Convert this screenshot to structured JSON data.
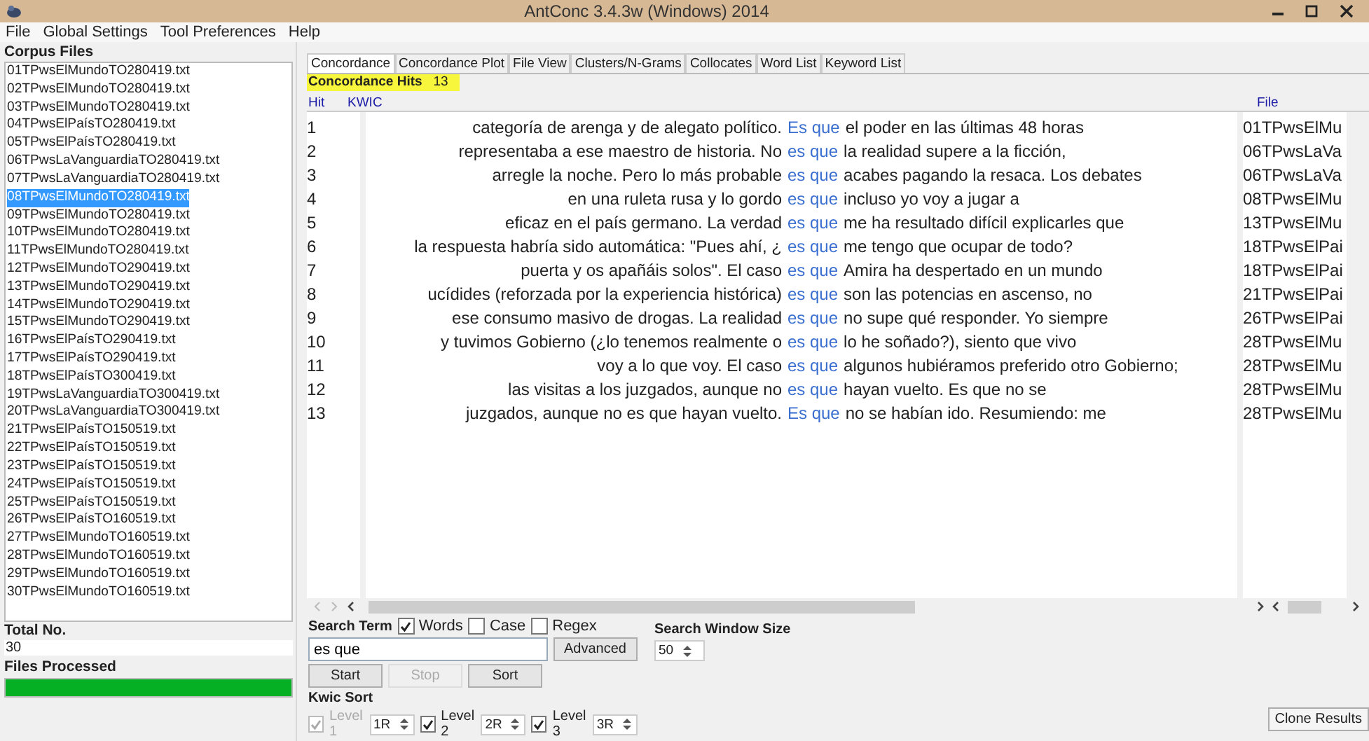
{
  "window": {
    "title": "AntConc 3.4.3w (Windows) 2014"
  },
  "menu": [
    "File",
    "Global Settings",
    "Tool Preferences",
    "Help"
  ],
  "corpus_files": {
    "heading": "Corpus Files",
    "items": [
      {
        "name": "01TPwsElMundoTO280419.txt",
        "selected": false
      },
      {
        "name": "02TPwsElMundoTO280419.txt",
        "selected": false
      },
      {
        "name": "03TPwsElMundoTO280419.txt",
        "selected": false
      },
      {
        "name": "04TPwsElPaísTO280419.txt",
        "selected": false
      },
      {
        "name": "05TPwsElPaísTO280419.txt",
        "selected": false
      },
      {
        "name": "06TPwsLaVanguardiaTO280419.txt",
        "selected": false
      },
      {
        "name": "07TPwsLaVanguardiaTO280419.txt",
        "selected": false
      },
      {
        "name": "08TPwsElMundoTO280419.txt",
        "selected": true
      },
      {
        "name": "09TPwsElMundoTO280419.txt",
        "selected": false
      },
      {
        "name": "10TPwsElMundoTO280419.txt",
        "selected": false
      },
      {
        "name": "11TPwsElMundoTO280419.txt",
        "selected": false
      },
      {
        "name": "12TPwsElMundoTO290419.txt",
        "selected": false
      },
      {
        "name": "13TPwsElMundoTO290419.txt",
        "selected": false
      },
      {
        "name": "14TPwsElMundoTO290419.txt",
        "selected": false
      },
      {
        "name": "15TPwsElMundoTO290419.txt",
        "selected": false
      },
      {
        "name": "16TPwsElPaísTO290419.txt",
        "selected": false
      },
      {
        "name": "17TPwsElPaísTO290419.txt",
        "selected": false
      },
      {
        "name": "18TPwsElPaísTO300419.txt",
        "selected": false
      },
      {
        "name": "19TPwsLaVanguardiaTO300419.txt",
        "selected": false
      },
      {
        "name": "20TPwsLaVanguardiaTO300419.txt",
        "selected": false
      },
      {
        "name": "21TPwsElPaísTO150519.txt",
        "selected": false
      },
      {
        "name": "22TPwsElPaísTO150519.txt",
        "selected": false
      },
      {
        "name": "23TPwsElPaísTO150519.txt",
        "selected": false
      },
      {
        "name": "24TPwsElPaísTO150519.txt",
        "selected": false
      },
      {
        "name": "25TPwsElPaísTO150519.txt",
        "selected": false
      },
      {
        "name": "26TPwsElPaísTO160519.txt",
        "selected": false
      },
      {
        "name": "27TPwsElMundoTO160519.txt",
        "selected": false
      },
      {
        "name": "28TPwsElMundoTO160519.txt",
        "selected": false
      },
      {
        "name": "29TPwsElMundoTO160519.txt",
        "selected": false
      },
      {
        "name": "30TPwsElMundoTO160519.txt",
        "selected": false
      }
    ]
  },
  "total": {
    "label": "Total No.",
    "value": "30"
  },
  "files_processed": {
    "label": "Files Processed",
    "level": 1
  },
  "tabs": [
    {
      "label": "Concordance",
      "selected": true
    },
    {
      "label": "Concordance Plot",
      "selected": false
    },
    {
      "label": "File View",
      "selected": false
    },
    {
      "label": "Clusters/N-Grams",
      "selected": false
    },
    {
      "label": "Collocates",
      "selected": false
    },
    {
      "label": "Word List",
      "selected": false
    },
    {
      "label": "Keyword List",
      "selected": false
    }
  ],
  "hits": {
    "label": "Concordance Hits",
    "count": "13"
  },
  "columns": [
    "Hit",
    "KWIC",
    "File"
  ],
  "rows": [
    {
      "hit": "1",
      "left": "categoría de arenga y de alegato político.",
      "keyword": "Es que",
      "right": "el poder en las últimas 48 horas",
      "file": "01TPwsElMu"
    },
    {
      "hit": "2",
      "left": "representaba a ese maestro de historia. No",
      "keyword": "es que",
      "right": "la realidad supere a la ficción,",
      "file": "06TPwsLaVa"
    },
    {
      "hit": "3",
      "left": "arregle la noche. Pero lo más probable",
      "keyword": "es que",
      "right": "acabes pagando la resaca. Los debates",
      "file": "06TPwsLaVa"
    },
    {
      "hit": "4",
      "left": "en una ruleta rusa y lo gordo",
      "keyword": "es que",
      "right": "incluso yo voy a jugar a",
      "file": "08TPwsElMu"
    },
    {
      "hit": "5",
      "left": "eficaz en el país germano.  La verdad",
      "keyword": "es que",
      "right": "me ha resultado difícil explicarles que",
      "file": "13TPwsElMu"
    },
    {
      "hit": "6",
      "left": "la respuesta habría sido automática: \"Pues ahí, ¿",
      "keyword": "es que",
      "right": "me tengo que ocupar de todo?",
      "file": "18TPwsElPai"
    },
    {
      "hit": "7",
      "left": "puerta y os apañáis solos\".  El caso",
      "keyword": "es que",
      "right": "Amira ha despertado en un mundo",
      "file": "18TPwsElPai"
    },
    {
      "hit": "8",
      "left": "ucídides (reforzada por la experiencia histórica)",
      "keyword": "es que",
      "right": "son las potencias en ascenso, no",
      "file": "21TPwsElPai"
    },
    {
      "hit": "9",
      "left": "ese consumo masivo de drogas. La realidad",
      "keyword": "es que",
      "right": "no supe qué responder. Yo siempre",
      "file": "26TPwsElPai"
    },
    {
      "hit": "10",
      "left": "y tuvimos Gobierno (¿lo tenemos realmente o",
      "keyword": "es que",
      "right": "lo he soñado?), siento que vivo",
      "file": "28TPwsElMu"
    },
    {
      "hit": "11",
      "left": "voy a lo que voy. El caso",
      "keyword": "es que",
      "right": "algunos hubiéramos preferido otro Gobierno;",
      "file": "28TPwsElMu"
    },
    {
      "hit": "12",
      "left": "las visitas a los juzgados, aunque no",
      "keyword": "es que",
      "right": "hayan vuelto. Es que no se",
      "file": "28TPwsElMu"
    },
    {
      "hit": "13",
      "left": "juzgados, aunque no es que hayan vuelto.",
      "keyword": "Es que",
      "right": "no se habían ido. Resumiendo: me",
      "file": "28TPwsElMu"
    }
  ],
  "search": {
    "label": "Search Term",
    "options": [
      {
        "label": "Words",
        "checked": true
      },
      {
        "label": "Case",
        "checked": false
      },
      {
        "label": "Regex",
        "checked": false
      }
    ],
    "value": "es que",
    "advanced": "Advanced",
    "window_size_label": "Search Window Size",
    "window_size": "50",
    "buttons": [
      {
        "label": "Start",
        "disabled": false
      },
      {
        "label": "Stop",
        "disabled": true
      },
      {
        "label": "Sort",
        "disabled": false
      }
    ]
  },
  "kwic_sort": {
    "label": "Kwic Sort",
    "levels": [
      {
        "label": "Level 1",
        "checked": true,
        "disabled": true,
        "value": "1R"
      },
      {
        "label": "Level 2",
        "checked": true,
        "disabled": false,
        "value": "2R"
      },
      {
        "label": "Level 3",
        "checked": true,
        "disabled": false,
        "value": "3R"
      }
    ]
  },
  "clone_button": "Clone Results"
}
